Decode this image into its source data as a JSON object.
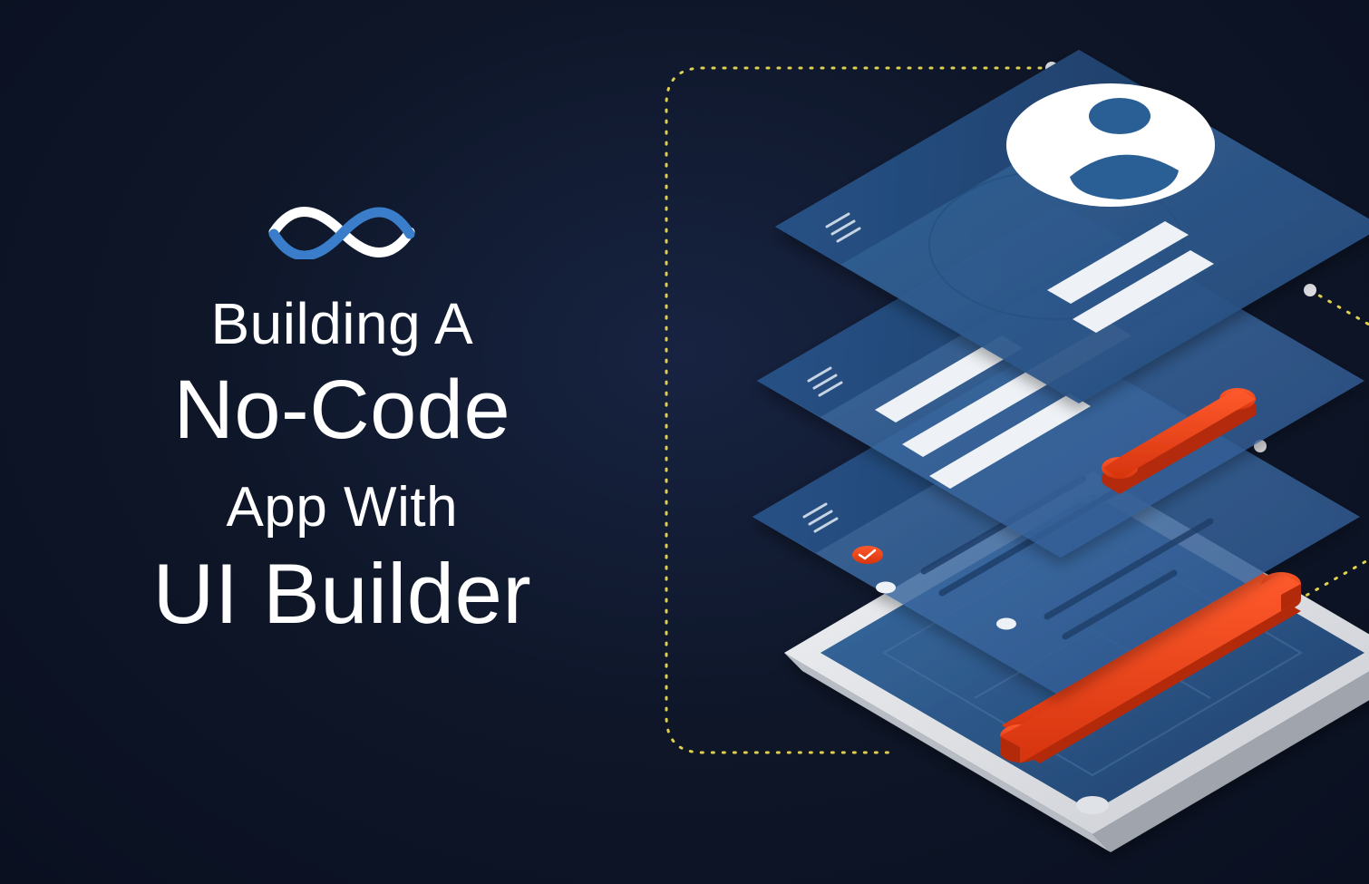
{
  "title": {
    "line1": "Building A",
    "line2": "No-Code",
    "line3": "App With",
    "line4": "UI Builder"
  },
  "colors": {
    "bg_dark": "#0e1628",
    "panel_blue": "#2b5a8f",
    "panel_blue_light": "#3a6ea5",
    "accent_orange": "#e8441f",
    "accent_orange_light": "#ff6a3d",
    "white": "#ffffff",
    "connector": "#e0d050"
  },
  "illustration": {
    "description": "Isometric exploded view of a mobile phone with three stacked UI layer panels floating above it, connected by dotted yellow lines",
    "layers": [
      "profile-screen",
      "form-screen",
      "list-screen",
      "phone-base"
    ]
  }
}
